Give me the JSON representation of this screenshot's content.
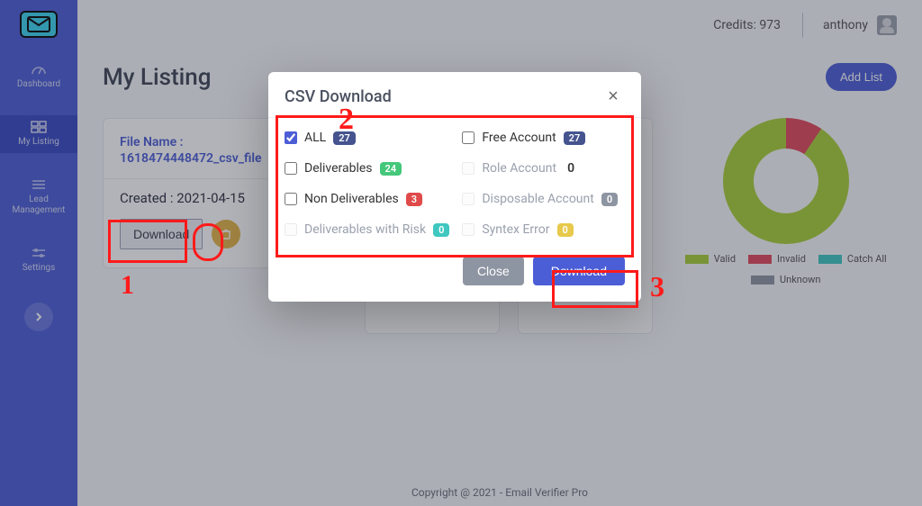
{
  "topbar": {
    "credits_label": "Credits: 973",
    "username": "anthony"
  },
  "sidebar": {
    "items": [
      {
        "label": "Dashboard"
      },
      {
        "label": "My Listing"
      },
      {
        "label": "Lead Management"
      },
      {
        "label": "Settings"
      }
    ]
  },
  "page": {
    "title": "My Listing",
    "add_list_label": "Add List"
  },
  "card": {
    "file_label": "File Name :",
    "file_name": "1618474448472_csv_file",
    "created_label": "Created : 2021-04-15",
    "download_label": "Download"
  },
  "legend": {
    "valid": "Valid",
    "invalid": "Invalid",
    "catch_all": "Catch All",
    "unknown": "Unknown",
    "colors": {
      "valid": "#a8cf3a",
      "invalid": "#e04a5c",
      "catch_all": "#3fc7c0",
      "unknown": "#8e95a2"
    }
  },
  "chart_data": {
    "type": "pie",
    "title": "",
    "series": [
      {
        "name": "Valid",
        "value": 24
      },
      {
        "name": "Invalid",
        "value": 3
      },
      {
        "name": "Catch All",
        "value": 0
      },
      {
        "name": "Unknown",
        "value": 0
      }
    ]
  },
  "modal": {
    "title": "CSV Download",
    "close_label": "Close",
    "download_label": "Download",
    "options": {
      "all": {
        "label": "ALL",
        "count": "27",
        "pill": "blue",
        "checked": true,
        "enabled": true
      },
      "free": {
        "label": "Free Account",
        "count": "27",
        "pill": "blue",
        "checked": false,
        "enabled": true
      },
      "deliverables": {
        "label": "Deliverables",
        "count": "24",
        "pill": "green",
        "checked": false,
        "enabled": true
      },
      "role": {
        "label": "Role Account",
        "count": "0",
        "pill": "",
        "checked": false,
        "enabled": false
      },
      "nondeliv": {
        "label": "Non Deliverables",
        "count": "3",
        "pill": "red",
        "checked": false,
        "enabled": true
      },
      "disposable": {
        "label": "Disposable Account",
        "count": "0",
        "pill": "gray",
        "checked": false,
        "enabled": false
      },
      "delivrisk": {
        "label": "Deliverables with Risk",
        "count": "0",
        "pill": "teal",
        "checked": false,
        "enabled": false
      },
      "syntex": {
        "label": "Syntex Error",
        "count": "0",
        "pill": "yellow",
        "checked": false,
        "enabled": false
      }
    }
  },
  "footer": {
    "text": "Copyright @ 2021 - Email Verifier Pro"
  },
  "annotations": {
    "one": "1",
    "two": "2",
    "three": "3"
  }
}
